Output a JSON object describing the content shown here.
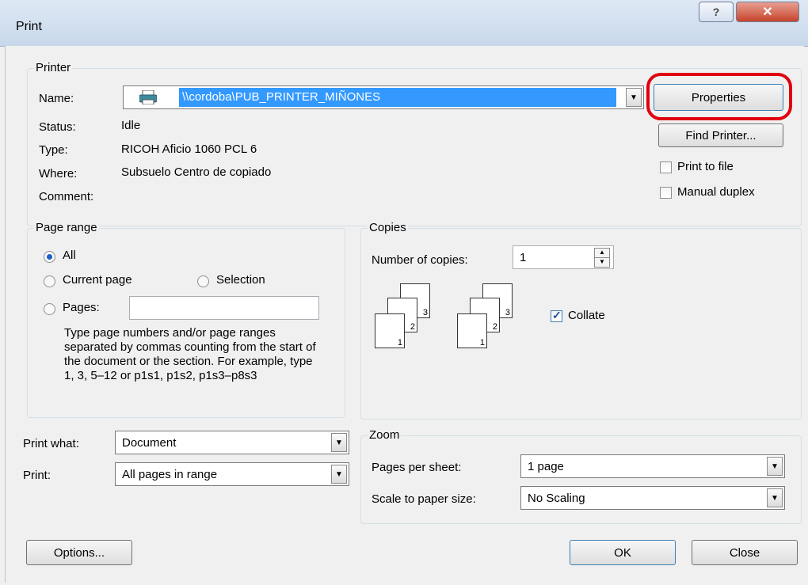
{
  "window": {
    "title": "Print",
    "help_glyph": "?",
    "close_glyph": "✕"
  },
  "printer": {
    "legend": "Printer",
    "name_label": "Name:",
    "name_value": "\\\\cordoba\\PUB_PRINTER_MIÑONES",
    "status_label": "Status:",
    "status_value": "Idle",
    "type_label": "Type:",
    "type_value": "RICOH Aficio 1060 PCL 6",
    "where_label": "Where:",
    "where_value": "Subsuelo Centro de copiado",
    "comment_label": "Comment:",
    "properties_label": "Properties",
    "find_label": "Find Printer...",
    "print_to_file": "Print to file",
    "manual_duplex": "Manual duplex",
    "highlight_color": "#e0000f"
  },
  "page_range": {
    "legend": "Page range",
    "all": "All",
    "current": "Current page",
    "selection": "Selection",
    "pages": "Pages:",
    "hint": "Type page numbers and/or page ranges separated by commas counting from the start of the document or the section. For example, type 1, 3, 5–12 or p1s1, p1s2, p1s3–p8s3"
  },
  "copies": {
    "legend": "Copies",
    "number_label": "Number of copies:",
    "number_value": "1",
    "collate": "Collate",
    "page_numbers": [
      "1",
      "2",
      "3"
    ]
  },
  "print_what": {
    "label": "Print what:",
    "value": "Document"
  },
  "print": {
    "label": "Print:",
    "value": "All pages in range"
  },
  "zoom": {
    "legend": "Zoom",
    "pages_label": "Pages per sheet:",
    "pages_value": "1 page",
    "scale_label": "Scale to paper size:",
    "scale_value": "No Scaling"
  },
  "buttons": {
    "options": "Options...",
    "ok": "OK",
    "close": "Close"
  }
}
